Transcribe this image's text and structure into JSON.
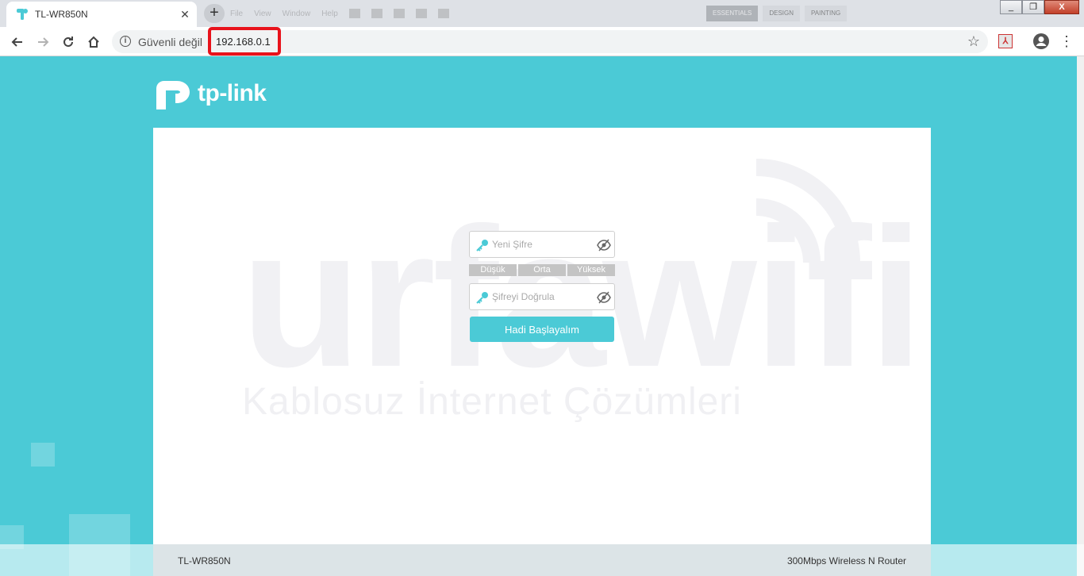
{
  "browser": {
    "tab_title": "TL-WR850N",
    "tab_close": "✕",
    "new_tab": "+",
    "security_label": "Güvenli değil",
    "url": "192.168.0.1",
    "ghost_menu": [
      "File",
      "View",
      "Window",
      "Help"
    ],
    "ghost_pills": [
      "ESSENTIALS",
      "DESIGN",
      "PAINTING"
    ],
    "win_minimize": "_",
    "win_maximize": "❐",
    "win_close": "X",
    "highlight_color": "#e8121b"
  },
  "brand": {
    "name": "tp-link",
    "accent_color": "#4bcad6"
  },
  "watermark": {
    "word": "urfawifi",
    "tagline": "Kablosuz İnternet Çözümleri"
  },
  "form": {
    "new_password_placeholder": "Yeni Şifre",
    "strength_levels": [
      "Düşük",
      "Orta",
      "Yüksek"
    ],
    "confirm_password_placeholder": "Şifreyi Doğrula",
    "submit_label": "Hadi Başlayalım"
  },
  "footer": {
    "model": "TL-WR850N",
    "description": "300Mbps Wireless N Router"
  },
  "icons": {
    "back": "back-arrow-icon",
    "forward": "forward-arrow-icon",
    "reload": "reload-icon",
    "home": "home-icon",
    "info": "info-icon",
    "star": "star-icon",
    "pdf": "pdf-extension-icon",
    "profile": "profile-icon",
    "menu": "kebab-menu-icon",
    "key": "key-icon",
    "eye": "eye-hidden-icon"
  }
}
